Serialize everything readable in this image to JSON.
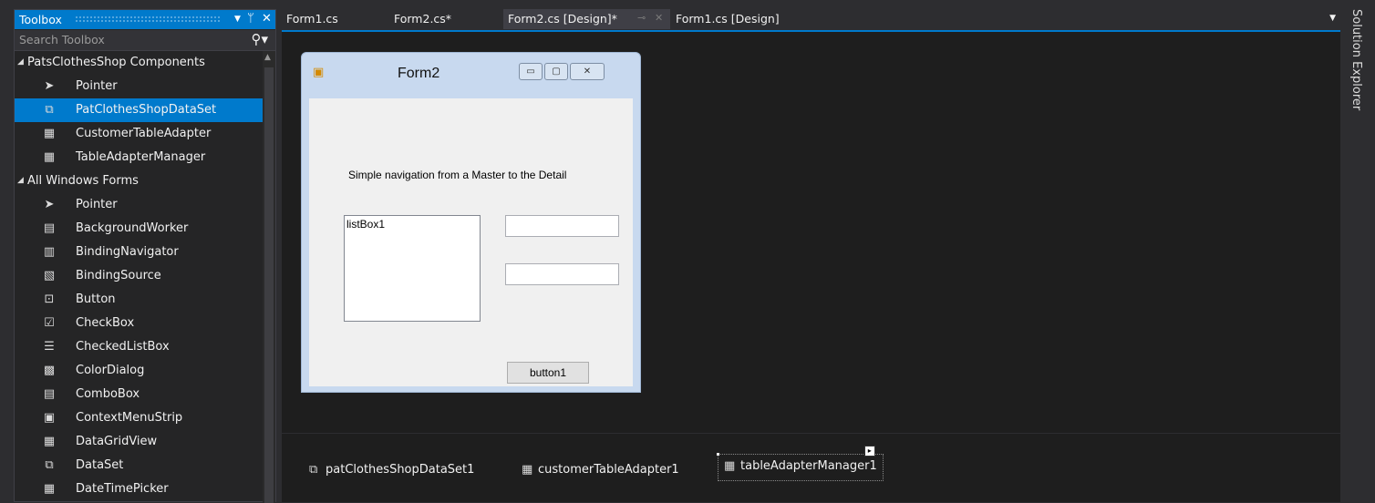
{
  "toolbox": {
    "title": "Toolbox",
    "search_placeholder": "Search Toolbox",
    "items": [
      {
        "type": "category",
        "label": "PatsClothesShop Components",
        "icon": "expanded-arrow-icon"
      },
      {
        "type": "item",
        "label": "Pointer",
        "icon": "pointer-icon"
      },
      {
        "type": "item",
        "label": "PatClothesShopDataSet",
        "icon": "dataset-component-icon",
        "selected": true
      },
      {
        "type": "item",
        "label": "CustomerTableAdapter",
        "icon": "table-adapter-icon"
      },
      {
        "type": "item",
        "label": "TableAdapterManager",
        "icon": "table-adapter-manager-icon"
      },
      {
        "type": "category",
        "label": "All Windows Forms",
        "icon": "expanded-arrow-icon"
      },
      {
        "type": "item",
        "label": "Pointer",
        "icon": "pointer-icon"
      },
      {
        "type": "item",
        "label": "BackgroundWorker",
        "icon": "background-worker-icon"
      },
      {
        "type": "item",
        "label": "BindingNavigator",
        "icon": "binding-navigator-icon"
      },
      {
        "type": "item",
        "label": "BindingSource",
        "icon": "binding-source-icon"
      },
      {
        "type": "item",
        "label": "Button",
        "icon": "button-control-icon"
      },
      {
        "type": "item",
        "label": "CheckBox",
        "icon": "checkbox-control-icon"
      },
      {
        "type": "item",
        "label": "CheckedListBox",
        "icon": "checked-listbox-icon"
      },
      {
        "type": "item",
        "label": "ColorDialog",
        "icon": "color-dialog-icon"
      },
      {
        "type": "item",
        "label": "ComboBox",
        "icon": "combobox-icon"
      },
      {
        "type": "item",
        "label": "ContextMenuStrip",
        "icon": "context-menu-strip-icon"
      },
      {
        "type": "item",
        "label": "DataGridView",
        "icon": "data-grid-view-icon"
      },
      {
        "type": "item",
        "label": "DataSet",
        "icon": "dataset-icon"
      },
      {
        "type": "item",
        "label": "DateTimePicker",
        "icon": "date-time-picker-icon"
      }
    ]
  },
  "tabs": [
    {
      "label": "Form1.cs",
      "active": false
    },
    {
      "label": "Form2.cs*",
      "active": false
    },
    {
      "label": "Form2.cs [Design]*",
      "active": true
    },
    {
      "label": "Form1.cs [Design]",
      "active": false
    }
  ],
  "side_rail": {
    "label": "Solution Explorer"
  },
  "form": {
    "title": "Form2",
    "label1": "Simple navigation from a Master to the Detail",
    "listbox_text": "listBox1",
    "button_text": "button1"
  },
  "tray": {
    "items": [
      {
        "label": "patClothesShopDataSet1",
        "icon": "dataset-component-icon"
      },
      {
        "label": "customerTableAdapter1",
        "icon": "table-adapter-icon"
      },
      {
        "label": "tableAdapterManager1",
        "icon": "table-adapter-manager-icon",
        "selected": true
      }
    ]
  },
  "colors": {
    "accent": "#007acc",
    "background": "#2d2d30",
    "designer_background": "#1e1e1e",
    "form_chrome": "#c8d9ef"
  }
}
